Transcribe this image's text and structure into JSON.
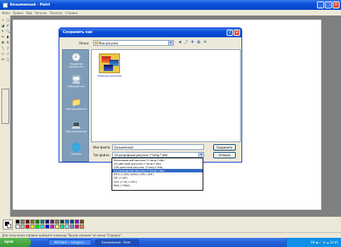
{
  "window": {
    "title": "Безымянный - Paint",
    "buttons": {
      "minimize": "_",
      "maximize": "□",
      "close": "✕"
    }
  },
  "menu": [
    "Файл",
    "Правка",
    "Вид",
    "Рисунок",
    "Палитра",
    "Справка"
  ],
  "toolbox": {
    "tools": [
      "✧",
      "▢",
      "◪",
      "✐",
      "✎",
      "🔍",
      "✏",
      "▮",
      "✿",
      "A",
      "╲",
      "∫",
      "▭",
      "▱",
      "⬭",
      "▢"
    ]
  },
  "palette": {
    "colors": [
      "#000000",
      "#808080",
      "#800000",
      "#808000",
      "#008000",
      "#008080",
      "#000080",
      "#800080",
      "#808040",
      "#004040",
      "#0080ff",
      "#004080",
      "#8000ff",
      "#804000",
      "#ffffff",
      "#c0c0c0",
      "#ff0000",
      "#ffff00",
      "#00ff00",
      "#00ffff",
      "#0000ff",
      "#ff00ff",
      "#ffff80",
      "#00ff80",
      "#80ffff",
      "#8080ff",
      "#ff0080",
      "#ff8040"
    ]
  },
  "statusbar": {
    "text": "Для получения справки выберите команду \"Вызов справки\" из меню \"Справка\"."
  },
  "taskbar": {
    "start": "пуск",
    "items": [
      {
        "label": "MS Paint — Lehrgrun ..."
      },
      {
        "label": "Безымянный - Paint"
      }
    ],
    "tray": "EN  ◀  🔊 ✉ ☁  10:45"
  },
  "dialog": {
    "title": "Сохранить как",
    "help": "?",
    "close": "✕",
    "save_in_label": "Папка:",
    "save_in_value": "Мои рисунки",
    "places": [
      {
        "label": "Недавние документы",
        "icon": "🕘"
      },
      {
        "label": "Рабочий стол",
        "icon": "🖥"
      },
      {
        "label": "Мои документы",
        "icon": "📁"
      },
      {
        "label": "Мой компьютер",
        "icon": "💻"
      },
      {
        "label": "Сетевое",
        "icon": "🌐"
      }
    ],
    "files": [
      {
        "label": "Образцы рисунков"
      }
    ],
    "filename_label": "Имя файла:",
    "filename_value": "Безымянный",
    "filetype_label": "Тип файла:",
    "filetype_value": "24-разрядный рисунок (*.bmp;*.dib)",
    "save_button": "Сохранить",
    "cancel_button": "Отмена",
    "filetype_options": [
      "Монохромный рисунок (*.bmp;*.dib)",
      "16-цветный рисунок (*.bmp;*.dib)",
      "256-цветный рисунок (*.bmp;*.dib)",
      "24-разрядный рисунок (*.bmp;*.dib)",
      "JPEG (*.JPG;*.JPEG;*.JPE;*.JFIF)",
      "GIF (*.GIF)",
      "TIFF (*.TIF;*.TIFF)",
      "PNG (*.PNG)"
    ],
    "filetype_selected_index": 3
  }
}
